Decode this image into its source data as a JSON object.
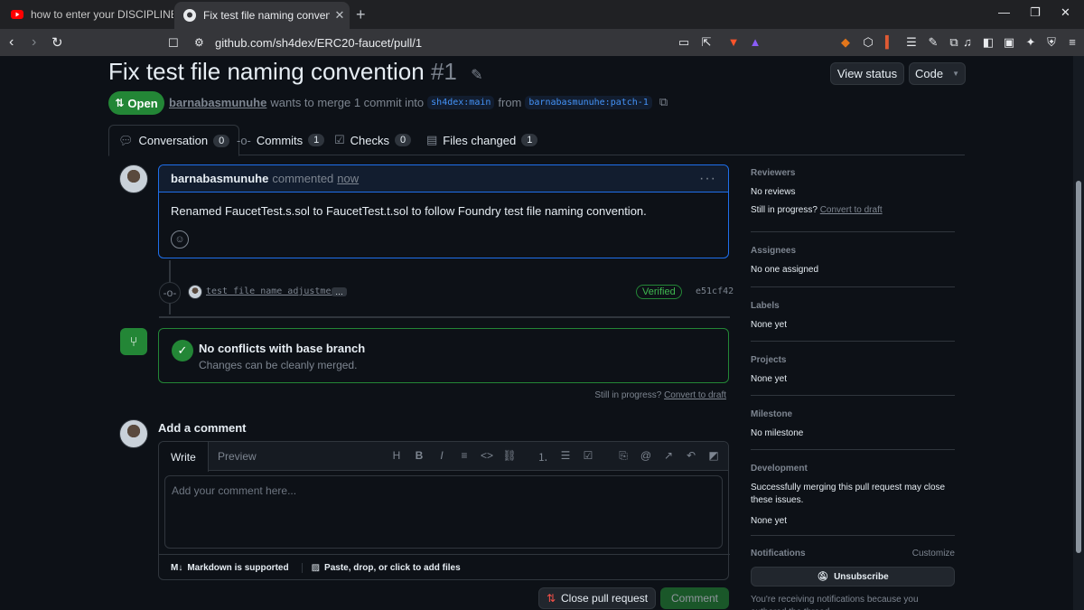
{
  "browser": {
    "tabs": [
      {
        "title": "how to enter your DISCIPLINED GIRL",
        "favicon": "youtube-icon"
      },
      {
        "title": "Fix test file naming convention b",
        "favicon": "github-icon"
      }
    ],
    "url": "github.com/sh4dex/ERC20-faucet/pull/1"
  },
  "pr": {
    "title": "Fix test file naming convention",
    "number": "#1",
    "state": "Open",
    "author": "barnabasmunuhe",
    "merge_text": "wants to merge 1 commit into",
    "base_branch": "sh4dex:main",
    "from_text": "from",
    "head_branch": "barnabasmunuhe:patch-1",
    "view_status": "View status",
    "code": "Code"
  },
  "tabs": [
    {
      "label": "Conversation",
      "count": "0"
    },
    {
      "label": "Commits",
      "count": "1"
    },
    {
      "label": "Checks",
      "count": "0"
    },
    {
      "label": "Files changed",
      "count": "1"
    }
  ],
  "comment": {
    "author": "barnabasmunuhe",
    "action": "commented",
    "time": "now",
    "body": "Renamed FaucetTest.s.sol to FaucetTest.t.sol to follow Foundry test file naming convention."
  },
  "commit": {
    "message": "test file name adjustment",
    "ellipsis": "…",
    "verified": "Verified",
    "sha": "e51cf42"
  },
  "merge": {
    "title": "No conflicts with base branch",
    "subtitle": "Changes can be cleanly merged."
  },
  "draft_note": {
    "text": "Still in progress?",
    "link": "Convert to draft"
  },
  "editor": {
    "heading": "Add a comment",
    "write_tab": "Write",
    "preview_tab": "Preview",
    "placeholder": "Add your comment here...",
    "markdown_note": "Markdown is supported",
    "attach_note": "Paste, drop, or click to add files"
  },
  "actions": {
    "close": "Close pull request",
    "comment": "Comment"
  },
  "sidebar": {
    "reviewers": {
      "title": "Reviewers",
      "value": "No reviews",
      "progress_text": "Still in progress?",
      "progress_link": "Convert to draft"
    },
    "assignees": {
      "title": "Assignees",
      "value": "No one assigned"
    },
    "labels": {
      "title": "Labels",
      "value": "None yet"
    },
    "projects": {
      "title": "Projects",
      "value": "None yet"
    },
    "milestone": {
      "title": "Milestone",
      "value": "No milestone"
    },
    "development": {
      "title": "Development",
      "text": "Successfully merging this pull request may close these issues.",
      "value": "None yet"
    },
    "notifications": {
      "title": "Notifications",
      "customize": "Customize",
      "unsubscribe": "Unsubscribe",
      "reason": "You're receiving notifications because you authored the thread."
    }
  },
  "colors": {
    "accent_green": "#238636",
    "link_blue": "#4493f8",
    "bg": "#0d1117"
  }
}
